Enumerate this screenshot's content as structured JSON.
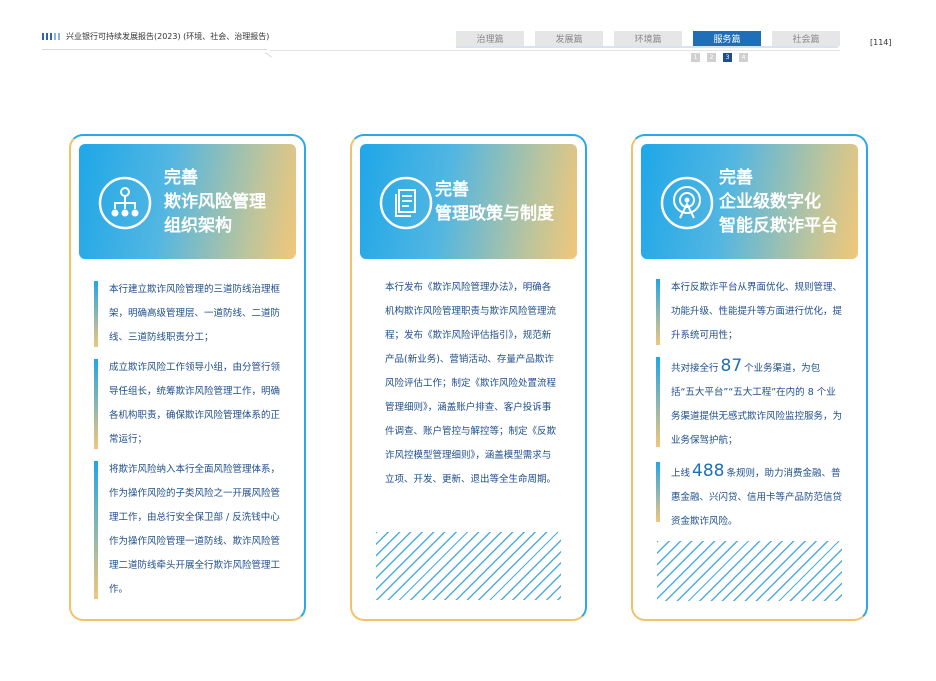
{
  "header": {
    "report_title": "兴业银行可持续发展报告(2023) (环境、社会、治理报告)",
    "page_number": "[114]"
  },
  "tabs": [
    {
      "label": "治理篇"
    },
    {
      "label": "发展篇"
    },
    {
      "label": "环境篇"
    },
    {
      "label": "服务篇"
    },
    {
      "label": "社会篇"
    }
  ],
  "active_tab": "服务篇",
  "section_numbers": [
    "1",
    "2",
    "3",
    "4"
  ],
  "cards": [
    {
      "title_line1": "完善",
      "title_line2": "欺诈风险管理",
      "title_line3": "组织架构",
      "icon": "org-structure-icon",
      "paragraphs": [
        "本行建立欺诈风险管理的三道防线治理框架，明确高级管理层、一道防线、二道防线、三道防线职责分工；",
        "成立欺诈风险工作领导小组，由分管行领导任组长，统筹欺诈风险管理工作，明确各机构职责，确保欺诈风险管理体系的正常运行；",
        "将欺诈风险纳入本行全面风险管理体系，作为操作风险的子类风险之一开展风险管理工作，由总行安全保卫部 / 反洗钱中心作为操作风险管理一道防线、欺诈风险管理二道防线牵头开展全行欺诈风险管理工作。"
      ]
    },
    {
      "title_line1": "完善",
      "title_line2": "管理政策与制度",
      "icon": "document-icon",
      "paragraph": "本行发布《欺诈风险管理办法》，明确各机构欺诈风险管理职责与欺诈风险管理流程；发布《欺诈风险评估指引》，规范新产品(新业务)、营销活动、存量产品欺诈风险评估工作；制定《欺诈风险处置流程管理细则》，涵盖账户排查、客户投诉事件调查、账户管控与解控等；制定《反欺诈风控模型管理细则》，涵盖模型需求与立项、开发、更新、退出等全生命周期。"
    },
    {
      "title_line1": "完善",
      "title_line2": "企业级数字化",
      "title_line3": "智能反欺诈平台",
      "icon": "radar-icon",
      "p1": "本行反欺诈平台从界面优化、规则管理、功能升级、性能提升等方面进行优化，提升系统可用性；",
      "p2_pre": "共对接全行",
      "p2_num": "87",
      "p2_post": "个业务渠道，为包括“五大平台”“五大工程”在内的 8 个业务渠道提供无感式欺诈风险监控服务，为业务保驾护航；",
      "p3_pre": "上线",
      "p3_num": "488",
      "p3_post": "条规则，助力消费金融、普惠金融、兴闪贷、信用卡等产品防范信贷资金欺诈风险。"
    }
  ]
}
